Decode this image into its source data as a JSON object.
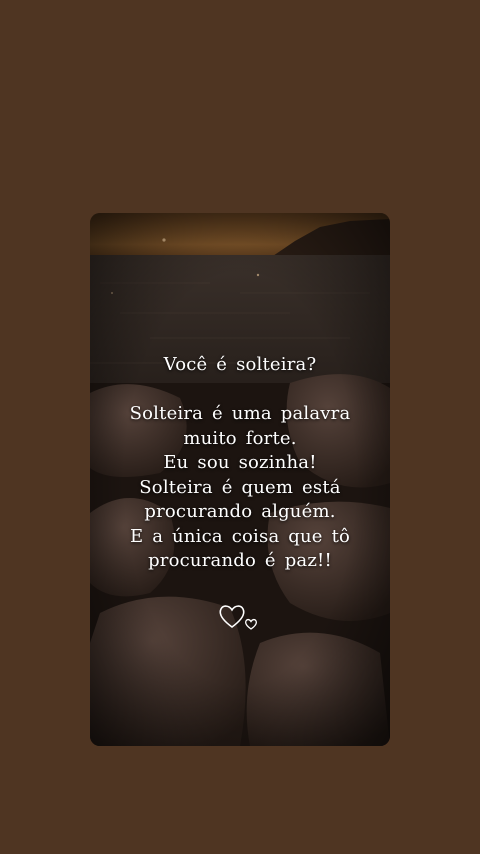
{
  "caption": {
    "question": "Você é solteira?",
    "lines": [
      "Solteira é uma palavra",
      "muito forte.",
      "Eu sou sozinha!",
      "Solteira é quem está",
      "procurando alguém.",
      "E a única coisa que tô",
      "procurando é paz!!"
    ]
  },
  "icons": {
    "decoration": "two-hearts-icon"
  },
  "colors": {
    "page_background": "#4f3522",
    "sky": "#5a3a1c",
    "sea": "#2e2824",
    "rocks": "#3a2d26",
    "text": "#ffffff"
  }
}
